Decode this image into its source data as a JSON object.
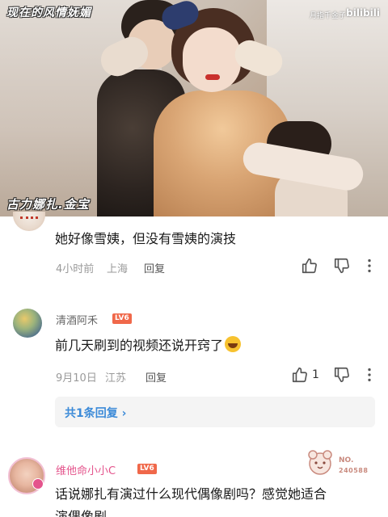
{
  "video": {
    "title_overlay": "现在的风情妩媚",
    "uploader": "月指千金子",
    "platform_logo": "bilibili",
    "caption": "古力娜扎.金宝"
  },
  "comments": [
    {
      "username": "",
      "text": "她好像雪姨，但没有雪姨的演技",
      "time": "4小时前",
      "location": "上海",
      "reply_label": "回复",
      "likes": ""
    },
    {
      "username": "清酒阿禾",
      "level": "LV6",
      "text": "前几天刷到的视频还说开窍了",
      "emoji": "laugh-cry-emoji",
      "time": "9月10日",
      "location": "江苏",
      "reply_label": "回复",
      "likes": "1",
      "replies_link": "共1条回复"
    },
    {
      "username": "维他命小小C",
      "level": "LV6",
      "text_line1": "话说娜扎有演过什么现代偶像剧吗？感觉她适合",
      "text_line2": "演偶像剧",
      "badge_no": "NO.",
      "badge_number": "240588"
    }
  ],
  "icons": {
    "like": "thumbs-up-icon",
    "dislike": "thumbs-down-icon",
    "more": "more-vertical-icon"
  },
  "colors": {
    "link_blue": "#3b8ad8",
    "vip_pink": "#e4548c",
    "level_orange": "#f0684a",
    "meta_gray": "#9a9a9a"
  }
}
